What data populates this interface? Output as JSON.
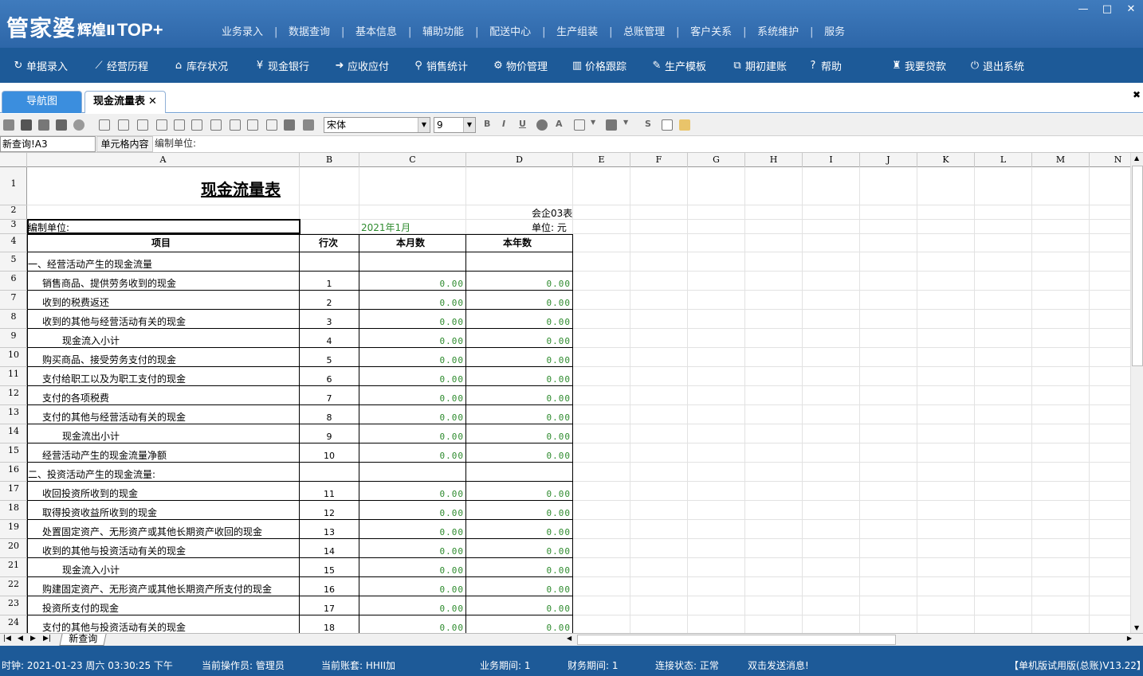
{
  "app": {
    "logo_main": "管家婆",
    "logo_sub": "辉煌Ⅱ",
    "logo_edition": "TOP+",
    "window_controls": [
      "minimize-icon",
      "maximize-icon",
      "close-icon"
    ]
  },
  "top_menu": [
    "业务录入",
    "数据查询",
    "基本信息",
    "辅助功能",
    "配送中心",
    "生产组装",
    "总账管理",
    "客户关系",
    "系统维护",
    "服务"
  ],
  "toolbar": [
    {
      "label": "单据录入",
      "icon": "refresh-icon",
      "glyph": "↻"
    },
    {
      "label": "经营历程",
      "icon": "chart-line-icon",
      "glyph": "⟋"
    },
    {
      "label": "库存状况",
      "icon": "house-icon",
      "glyph": "⌂"
    },
    {
      "label": "现金银行",
      "icon": "yen-icon",
      "glyph": "¥"
    },
    {
      "label": "应收应付",
      "icon": "arrow-icon",
      "glyph": "➜"
    },
    {
      "label": "销售统计",
      "icon": "search-icon",
      "glyph": "⚲"
    },
    {
      "label": "物价管理",
      "icon": "gear-icon",
      "glyph": "⚙"
    },
    {
      "label": "价格跟踪",
      "icon": "bar-chart-icon",
      "glyph": "▥"
    },
    {
      "label": "生产模板",
      "icon": "wrench-icon",
      "glyph": "✎"
    },
    {
      "label": "期初建账",
      "icon": "external-link-icon",
      "glyph": "⧉"
    },
    {
      "label": "帮助",
      "icon": "help-icon",
      "glyph": "?"
    },
    {
      "label": "我要贷款",
      "icon": "bag-icon",
      "glyph": "♜"
    },
    {
      "label": "退出系统",
      "icon": "power-icon",
      "glyph": "⏻"
    }
  ],
  "tabs": {
    "nav": "导航图",
    "cash": "现金流量表",
    "close_glyph": "✕"
  },
  "format_bar": {
    "font": "宋体",
    "size": "9"
  },
  "formula_bar": {
    "cell_ref": "新查询!A3",
    "label": "单元格内容",
    "content": "编制单位:"
  },
  "columns": [
    "A",
    "B",
    "C",
    "D",
    "E",
    "F",
    "G",
    "H",
    "I",
    "J",
    "K",
    "L",
    "M",
    "N"
  ],
  "rows": [
    "1",
    "2",
    "3",
    "4",
    "5",
    "6",
    "7",
    "8",
    "9",
    "10",
    "11",
    "12",
    "13",
    "14",
    "15",
    "16",
    "17",
    "18",
    "19",
    "20",
    "21",
    "22",
    "23",
    "24"
  ],
  "report": {
    "title": "现金流量表",
    "form_code": "会企03表",
    "company_label": "编制单位:",
    "period": "2021年1月",
    "unit": "单位: 元",
    "header": {
      "item": "项目",
      "line": "行次",
      "month": "本月数",
      "year": "本年数"
    },
    "lines": [
      {
        "item": "一、经营活动产生的现金流量",
        "line": "",
        "month": "",
        "year": "",
        "indent": 0
      },
      {
        "item": "销售商品、提供劳务收到的现金",
        "line": "1",
        "month": "0.00",
        "year": "0.00",
        "indent": 1
      },
      {
        "item": "收到的税费返还",
        "line": "2",
        "month": "0.00",
        "year": "0.00",
        "indent": 1
      },
      {
        "item": "收到的其他与经营活动有关的现金",
        "line": "3",
        "month": "0.00",
        "year": "0.00",
        "indent": 1
      },
      {
        "item": "现金流入小计",
        "line": "4",
        "month": "0.00",
        "year": "0.00",
        "indent": 2
      },
      {
        "item": "购买商品、接受劳务支付的现金",
        "line": "5",
        "month": "0.00",
        "year": "0.00",
        "indent": 1
      },
      {
        "item": "支付给职工以及为职工支付的现金",
        "line": "6",
        "month": "0.00",
        "year": "0.00",
        "indent": 1
      },
      {
        "item": "支付的各项税费",
        "line": "7",
        "month": "0.00",
        "year": "0.00",
        "indent": 1
      },
      {
        "item": "支付的其他与经营活动有关的现金",
        "line": "8",
        "month": "0.00",
        "year": "0.00",
        "indent": 1
      },
      {
        "item": "现金流出小计",
        "line": "9",
        "month": "0.00",
        "year": "0.00",
        "indent": 2
      },
      {
        "item": "经营活动产生的现金流量净额",
        "line": "10",
        "month": "0.00",
        "year": "0.00",
        "indent": 1
      },
      {
        "item": "二、投资活动产生的现金流量:",
        "line": "",
        "month": "",
        "year": "",
        "indent": 0
      },
      {
        "item": "收回投资所收到的现金",
        "line": "11",
        "month": "0.00",
        "year": "0.00",
        "indent": 1
      },
      {
        "item": "取得投资收益所收到的现金",
        "line": "12",
        "month": "0.00",
        "year": "0.00",
        "indent": 1
      },
      {
        "item": "处置固定资产、无形资产或其他长期资产收回的现金",
        "line": "13",
        "month": "0.00",
        "year": "0.00",
        "indent": 1
      },
      {
        "item": "收到的其他与投资活动有关的现金",
        "line": "14",
        "month": "0.00",
        "year": "0.00",
        "indent": 1
      },
      {
        "item": "现金流入小计",
        "line": "15",
        "month": "0.00",
        "year": "0.00",
        "indent": 2
      },
      {
        "item": "购建固定资产、无形资产或其他长期资产所支付的现金",
        "line": "16",
        "month": "0.00",
        "year": "0.00",
        "indent": 1
      },
      {
        "item": "投资所支付的现金",
        "line": "17",
        "month": "0.00",
        "year": "0.00",
        "indent": 1
      },
      {
        "item": "支付的其他与投资活动有关的现金",
        "line": "18",
        "month": "0.00",
        "year": "0.00",
        "indent": 1
      }
    ]
  },
  "sheet_tab": "新查询",
  "status": {
    "clock": "时钟: 2021-01-23 周六 03:30:25 下午",
    "operator": "当前操作员: 管理员",
    "account": "当前账套: HHII加",
    "biz_period": "业务期间: 1",
    "fin_period": "财务期间: 1",
    "conn": "连接状态: 正常",
    "msg": "双击发送消息!",
    "version": "【单机版试用版(总账)V13.22】"
  },
  "colors": {
    "title_bar": "#2d66a8",
    "toolbar": "#1d5a98",
    "tab_active_nav": "#3b8ede",
    "number_green": "#2e8b2e"
  }
}
